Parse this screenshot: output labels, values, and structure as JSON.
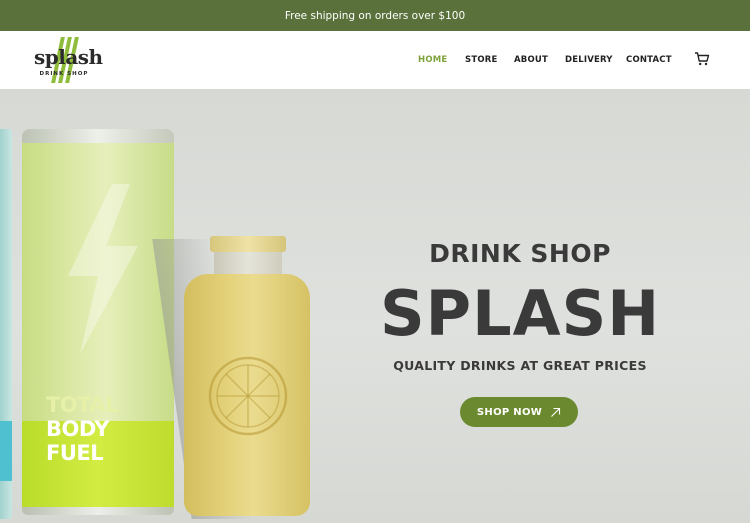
{
  "topbar": {
    "promo_text": "Free shipping on orders over $100"
  },
  "logo": {
    "word": "splash",
    "subtitle": "DRINK SHOP"
  },
  "nav": {
    "items": [
      {
        "label": "HOME",
        "active": true
      },
      {
        "label": "STORE",
        "active": false
      },
      {
        "label": "ABOUT",
        "active": false
      },
      {
        "label": "DELIVERY",
        "active": false
      },
      {
        "label": "CONTACT",
        "active": false
      }
    ],
    "cart_icon": "cart-icon"
  },
  "hero": {
    "eyebrow": "DRINK SHOP",
    "title": "SPLASH",
    "tagline": "QUALITY DRINKS AT GREAT PRICES",
    "cta_label": "SHOP NOW",
    "cta_icon": "arrow-up-right-icon",
    "can_text": [
      "TOTAL",
      "BODY",
      "FUEL"
    ]
  },
  "colors": {
    "topbar_bg": "#5a713b",
    "accent": "#7ea33a",
    "cta_bg": "#6b8a2f"
  }
}
